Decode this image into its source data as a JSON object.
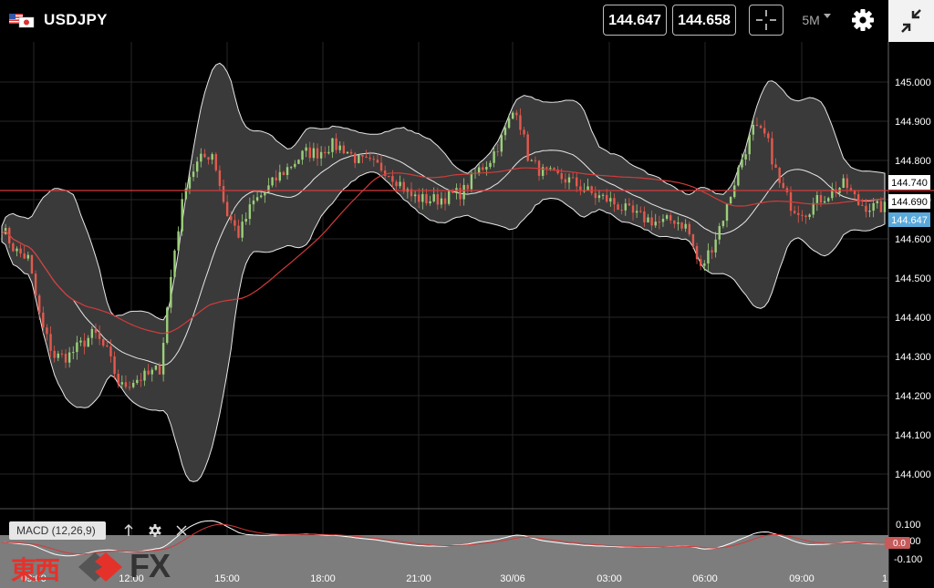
{
  "header": {
    "symbol": "USDJPY",
    "bid": "144.647",
    "ask": "144.658",
    "timeframe": "5M"
  },
  "colors": {
    "background": "#000000",
    "candle_up": "#9ccf7a",
    "candle_down": "#e4594d",
    "band": "#3a3a3a",
    "moving_average": "#d33a3a",
    "bid_tag": "#5aa9dc",
    "current_tag": "#ffffff"
  },
  "price_axis": {
    "ticks": [
      "145.000",
      "144.900",
      "144.800",
      "144.700",
      "144.600",
      "144.500",
      "144.400",
      "144.300",
      "144.200",
      "144.100",
      "144.000"
    ],
    "tags": {
      "upper": "144.740",
      "mid": "144.690",
      "bid": "144.647"
    }
  },
  "time_axis": {
    "ticks": [
      "09:00",
      "12:00",
      "15:00",
      "18:00",
      "21:00",
      "30/06",
      "03:00",
      "06:00",
      "09:00",
      "1"
    ]
  },
  "macd": {
    "label": "MACD (12,26,9)",
    "ticks": [
      "0.100",
      "0.000",
      "-0.100"
    ],
    "value_tag": "0.0"
  },
  "logo": {
    "kanji": "東西",
    "fx": "FX"
  },
  "chart_data": {
    "type": "candlestick",
    "symbol": "USDJPY",
    "interval": "5M",
    "ylim": [
      143.95,
      145.07
    ],
    "x_labels": [
      "09:00",
      "12:00",
      "15:00",
      "18:00",
      "21:00",
      "30/06",
      "03:00",
      "06:00",
      "09:00"
    ],
    "close_path": [
      [
        0,
        144.63
      ],
      [
        0.3,
        144.57
      ],
      [
        0.6,
        144.55
      ],
      [
        0.9,
        144.38
      ],
      [
        1.2,
        144.3
      ],
      [
        1.5,
        144.3
      ],
      [
        1.8,
        144.33
      ],
      [
        2.1,
        144.36
      ],
      [
        2.4,
        144.31
      ],
      [
        2.7,
        144.22
      ],
      [
        3.0,
        144.24
      ],
      [
        3.3,
        144.25
      ],
      [
        3.6,
        144.27
      ],
      [
        3.9,
        144.55
      ],
      [
        4.2,
        144.75
      ],
      [
        4.5,
        144.8
      ],
      [
        4.8,
        144.82
      ],
      [
        5.1,
        144.67
      ],
      [
        5.4,
        144.61
      ],
      [
        5.7,
        144.69
      ],
      [
        6.0,
        144.72
      ],
      [
        6.3,
        144.76
      ],
      [
        6.6,
        144.79
      ],
      [
        6.9,
        144.82
      ],
      [
        7.2,
        144.82
      ],
      [
        7.5,
        144.84
      ],
      [
        7.8,
        144.83
      ],
      [
        8.1,
        144.8
      ],
      [
        8.4,
        144.79
      ],
      [
        8.7,
        144.78
      ],
      [
        9.0,
        144.75
      ],
      [
        9.3,
        144.71
      ],
      [
        9.6,
        144.7
      ],
      [
        9.9,
        144.7
      ],
      [
        10.2,
        144.71
      ],
      [
        10.5,
        144.72
      ],
      [
        10.8,
        144.77
      ],
      [
        11.1,
        144.8
      ],
      [
        11.4,
        144.86
      ],
      [
        11.7,
        144.94
      ],
      [
        12.0,
        144.8
      ],
      [
        12.3,
        144.77
      ],
      [
        12.6,
        144.76
      ],
      [
        12.9,
        144.75
      ],
      [
        13.2,
        144.73
      ],
      [
        13.5,
        144.71
      ],
      [
        13.8,
        144.7
      ],
      [
        14.1,
        144.68
      ],
      [
        14.4,
        144.66
      ],
      [
        14.7,
        144.65
      ],
      [
        15.0,
        144.64
      ],
      [
        15.3,
        144.65
      ],
      [
        15.6,
        144.63
      ],
      [
        15.9,
        144.52
      ],
      [
        16.2,
        144.59
      ],
      [
        16.5,
        144.68
      ],
      [
        16.8,
        144.79
      ],
      [
        17.1,
        144.88
      ],
      [
        17.4,
        144.86
      ],
      [
        17.7,
        144.74
      ],
      [
        18.0,
        144.68
      ],
      [
        18.3,
        144.67
      ],
      [
        18.6,
        144.7
      ],
      [
        18.9,
        144.72
      ],
      [
        19.2,
        144.74
      ],
      [
        19.5,
        144.69
      ],
      [
        19.8,
        144.68
      ],
      [
        20.1,
        144.68
      ]
    ],
    "price_tags": [
      144.74,
      144.69,
      144.647
    ]
  }
}
